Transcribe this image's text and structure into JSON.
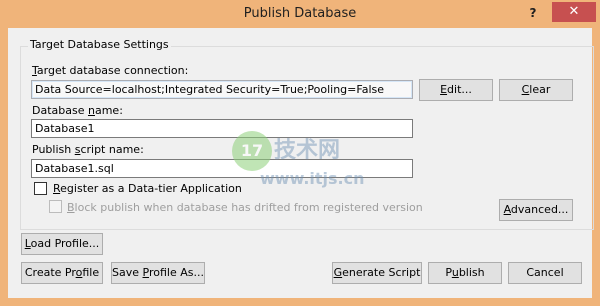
{
  "window": {
    "title": "Publish Database",
    "help_glyph": "?",
    "close_glyph": "✕",
    "accent_color": "#f0b47a"
  },
  "group": {
    "label": "Target Database Settings"
  },
  "connection": {
    "label_mnemonic": "T",
    "label_rest": "arget database connection:",
    "value": "Data Source=localhost;Integrated Security=True;Pooling=False",
    "edit_mnemonic": "E",
    "edit_rest": "dit...",
    "clear_mnemonic": "C",
    "clear_rest": "lear"
  },
  "database_name": {
    "label_pre": "Database ",
    "label_mnemonic": "n",
    "label_post": "ame:",
    "value": "Database1"
  },
  "script_name": {
    "label_pre": "Publish ",
    "label_mnemonic": "s",
    "label_post": "cript name:",
    "value": "Database1.sql"
  },
  "register": {
    "mnemonic": "R",
    "rest": "egister as a Data-tier Application",
    "checked": false
  },
  "block_publish": {
    "mnemonic": "B",
    "rest": "lock publish when database has drifted from registered version",
    "checked": false,
    "enabled": false
  },
  "advanced": {
    "mnemonic": "A",
    "rest": "dvanced..."
  },
  "footer": {
    "load_profile_mnemonic": "L",
    "load_profile_rest": "oad Profile...",
    "create_profile_pre": "Create Pr",
    "create_profile_mnemonic": "o",
    "create_profile_post": "file",
    "save_profile_pre": "Save ",
    "save_profile_mnemonic": "P",
    "save_profile_post": "rofile As...",
    "generate_script_mnemonic": "G",
    "generate_script_rest": "enerate Script",
    "publish_pre": "P",
    "publish_mnemonic": "u",
    "publish_post": "blish",
    "cancel": "Cancel"
  },
  "watermark": {
    "logo": "17",
    "site_cn": "技术网",
    "url": "www.itjs.cn"
  }
}
